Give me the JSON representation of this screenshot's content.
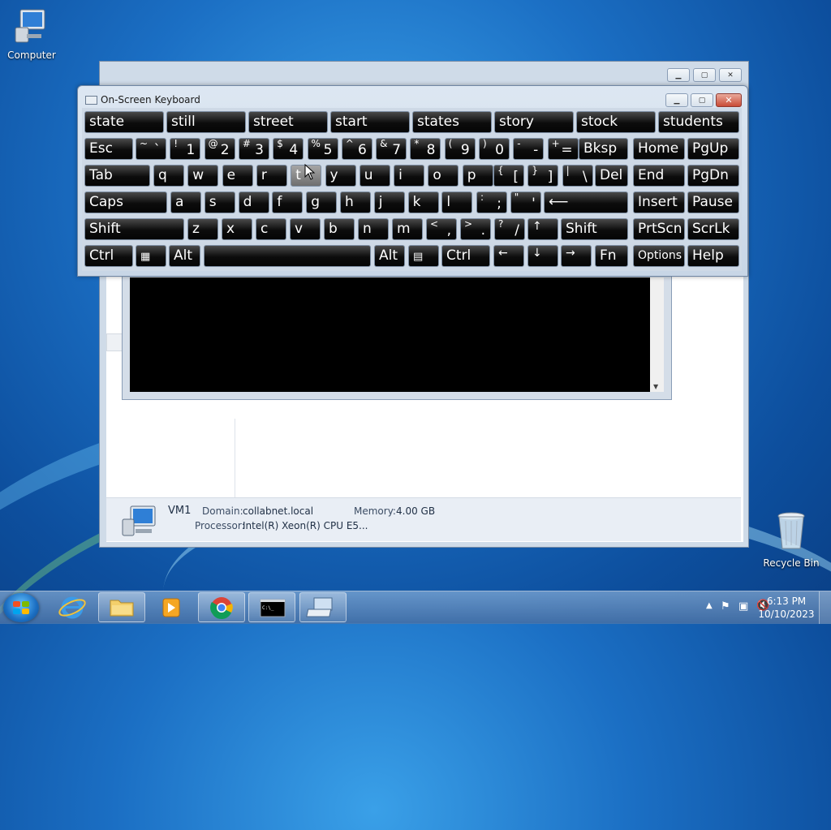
{
  "desktop": {
    "icons": [
      {
        "label": "Computer"
      },
      {
        "label": "Recycle Bin"
      }
    ]
  },
  "background_window": {
    "details": {
      "name": "VM1",
      "domain_label": "Domain:",
      "domain_value": "collabnet.local",
      "memory_label": "Memory:",
      "memory_value": "4.00 GB",
      "processor_label": "Processor:",
      "processor_value": "Intel(R) Xeon(R) CPU E5..."
    }
  },
  "osk": {
    "title": "On-Screen Keyboard",
    "suggestions": [
      "state",
      "still",
      "street",
      "start",
      "states",
      "story",
      "stock",
      "students"
    ],
    "row1": {
      "esc": "Esc",
      "digits": [
        {
          "s": "~",
          "m": "`"
        },
        {
          "s": "!",
          "m": "1"
        },
        {
          "s": "@",
          "m": "2"
        },
        {
          "s": "#",
          "m": "3"
        },
        {
          "s": "$",
          "m": "4"
        },
        {
          "s": "%",
          "m": "5"
        },
        {
          "s": "^",
          "m": "6"
        },
        {
          "s": "&",
          "m": "7"
        },
        {
          "s": "*",
          "m": "8"
        },
        {
          "s": "(",
          "m": "9"
        },
        {
          "s": ")",
          "m": "0"
        },
        {
          "s": "-",
          "m": "-"
        },
        {
          "s": "+",
          "m": "="
        }
      ],
      "bksp": "Bksp",
      "home": "Home",
      "pgup": "PgUp"
    },
    "row2": {
      "tab": "Tab",
      "letters": [
        "q",
        "w",
        "e",
        "r",
        "t",
        "y",
        "u",
        "i",
        "o",
        "p"
      ],
      "brackets": [
        {
          "s": "{",
          "m": "["
        },
        {
          "s": "}",
          "m": "]"
        },
        {
          "s": "|",
          "m": "\\"
        }
      ],
      "del": "Del",
      "end": "End",
      "pgdn": "PgDn"
    },
    "row3": {
      "caps": "Caps",
      "letters": [
        "a",
        "s",
        "d",
        "f",
        "g",
        "h",
        "j",
        "k",
        "l"
      ],
      "punct": [
        {
          "s": ":",
          "m": ";"
        },
        {
          "s": "\"",
          "m": "'"
        }
      ],
      "enter": "⟵",
      "insert": "Insert",
      "pause": "Pause"
    },
    "row4": {
      "shift": "Shift",
      "letters": [
        "z",
        "x",
        "c",
        "v",
        "b",
        "n",
        "m"
      ],
      "punct": [
        {
          "s": "<",
          "m": ","
        },
        {
          "s": ">",
          "m": "."
        },
        {
          "s": "?",
          "m": "/"
        }
      ],
      "up": "↑",
      "shift_r": "Shift",
      "prtscn": "PrtScn",
      "scrlk": "ScrLk"
    },
    "row5": {
      "ctrl": "Ctrl",
      "alt": "Alt",
      "alt_r": "Alt",
      "ctrl_r": "Ctrl",
      "left": "←",
      "down": "↓",
      "right": "→",
      "fn": "Fn",
      "options": "Options",
      "help": "Help"
    }
  },
  "taskbar": {
    "clock_time": "6:13 PM",
    "clock_date": "10/10/2023",
    "apps": [
      "start-button",
      "internet-explorer",
      "windows-explorer",
      "media-player",
      "chrome",
      "command-prompt",
      "on-screen-keyboard"
    ]
  }
}
